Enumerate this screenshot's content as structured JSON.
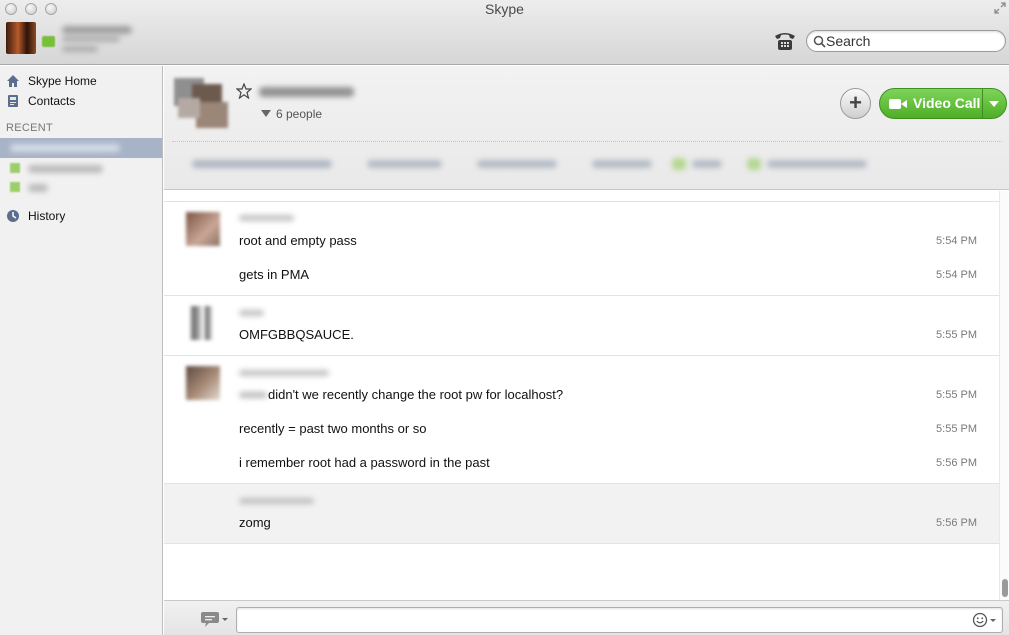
{
  "window": {
    "title": "Skype"
  },
  "toolbar": {
    "search_placeholder": "Search",
    "phone_icon": "phone-icon",
    "search_icon": "magnifier-icon"
  },
  "sidebar": {
    "items": [
      {
        "label": "Skype Home",
        "icon": "home-icon"
      },
      {
        "label": "Contacts",
        "icon": "contacts-book-icon"
      }
    ],
    "recent_header": "RECENT",
    "history": {
      "label": "History",
      "icon": "clock-icon"
    }
  },
  "conversation": {
    "people_count": "6 people",
    "video_call_label": "Video Call",
    "add_label": "+",
    "colors": {
      "accent_green": "#5cbf34",
      "selected_row": "#a7b3c6"
    }
  },
  "messages": {
    "groups": [
      {
        "lines": [
          {
            "text": "root and empty pass",
            "time": "5:54 PM"
          },
          {
            "text": "gets in PMA",
            "time": "5:54 PM"
          }
        ]
      },
      {
        "lines": [
          {
            "text": "OMFGBBQSAUCE.",
            "time": "5:55 PM"
          }
        ]
      },
      {
        "lines": [
          {
            "text": "didn't we recently change the root pw for localhost?",
            "time": "5:55 PM"
          },
          {
            "text": "recently = past two months or so",
            "time": "5:55 PM"
          },
          {
            "text": "i remember root had a password in the past",
            "time": "5:56 PM"
          }
        ]
      },
      {
        "lines": [
          {
            "text": "zomg",
            "time": "5:56 PM"
          }
        ]
      }
    ]
  }
}
